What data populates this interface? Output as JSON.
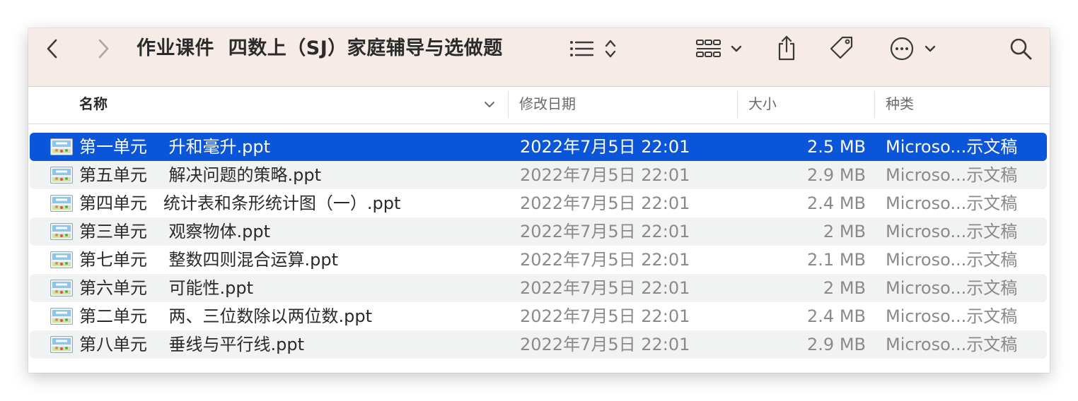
{
  "toolbar": {
    "title": "作业课件  四数上（SJ）家庭辅导与选做题",
    "back_icon": "chevron-left-icon",
    "forward_icon": "chevron-right-icon",
    "list_view_icon": "list-icon",
    "sort_icon": "up-down-chevron-icon",
    "group_icon": "grid-icon",
    "share_icon": "share-icon",
    "tag_icon": "tag-icon",
    "more_icon": "ellipsis-circle-icon",
    "search_icon": "search-icon"
  },
  "columns": {
    "name": "名称",
    "date": "修改日期",
    "size": "大小",
    "kind": "种类"
  },
  "files": [
    {
      "name": "第一单元    升和毫升.ppt",
      "date": "2022年7月5日 22:01",
      "size": "2.5 MB",
      "kind": "Microso...示文稿",
      "selected": true
    },
    {
      "name": "第五单元    解决问题的策略.ppt",
      "date": "2022年7月5日 22:01",
      "size": "2.9 MB",
      "kind": "Microso...示文稿"
    },
    {
      "name": "第四单元   统计表和条形统计图（一）.ppt",
      "date": "2022年7月5日 22:01",
      "size": "2.4 MB",
      "kind": "Microso...示文稿"
    },
    {
      "name": "第三单元    观察物体.ppt",
      "date": "2022年7月5日 22:01",
      "size": "2 MB",
      "kind": "Microso...示文稿"
    },
    {
      "name": "第七单元    整数四则混合运算.ppt",
      "date": "2022年7月5日 22:01",
      "size": "2.1 MB",
      "kind": "Microso...示文稿"
    },
    {
      "name": "第六单元    可能性.ppt",
      "date": "2022年7月5日 22:01",
      "size": "2 MB",
      "kind": "Microso...示文稿"
    },
    {
      "name": "第二单元    两、三位数除以两位数.ppt",
      "date": "2022年7月5日 22:01",
      "size": "2.4 MB",
      "kind": "Microso...示文稿"
    },
    {
      "name": "第八单元    垂线与平行线.ppt",
      "date": "2022年7月5日 22:01",
      "size": "2.9 MB",
      "kind": "Microso...示文稿"
    }
  ],
  "colors": {
    "toolbar_bg": "#f6ebe6",
    "selection": "#0a55d8",
    "alt_row": "#f1f2f2"
  }
}
